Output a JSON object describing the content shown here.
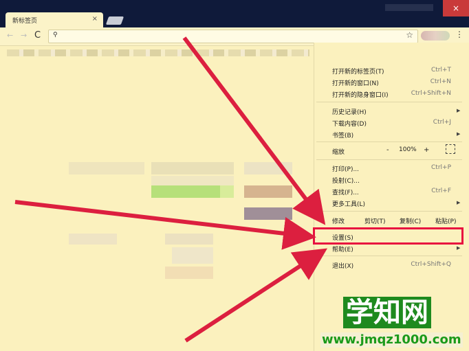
{
  "browser": {
    "tab_title": "新标签页",
    "tab_close": "×",
    "window_close": "×",
    "back": "←",
    "forward": "→",
    "reload": "C",
    "menu_icon": "⋮"
  },
  "menu": {
    "items": [
      {
        "label": "打开新的标签页(T)",
        "shortcut": "Ctrl+T"
      },
      {
        "label": "打开新的窗口(N)",
        "shortcut": "Ctrl+N"
      },
      {
        "label": "打开新的隐身窗口(I)",
        "shortcut": "Ctrl+Shift+N"
      },
      {
        "label": "历史记录(H)",
        "shortcut": ""
      },
      {
        "label": "下载内容(D)",
        "shortcut": "Ctrl+J"
      },
      {
        "label": "书签(B)",
        "shortcut": ""
      },
      {
        "label": "缩放",
        "shortcut": ""
      },
      {
        "label": "打印(P)...",
        "shortcut": "Ctrl+P"
      },
      {
        "label": "投射(C)...",
        "shortcut": ""
      },
      {
        "label": "查找(F)...",
        "shortcut": "Ctrl+F"
      },
      {
        "label": "更多工具(L)",
        "shortcut": ""
      },
      {
        "label": "设置(S)",
        "shortcut": ""
      },
      {
        "label": "帮助(E)",
        "shortcut": ""
      },
      {
        "label": "退出(X)",
        "shortcut": "Ctrl+Shift+Q"
      }
    ],
    "zoom": {
      "minus": "-",
      "value": "100%",
      "plus": "+"
    },
    "edit": {
      "label": "修改",
      "cut": "剪切(T)",
      "copy": "复制(C)",
      "paste": "粘贴(P)"
    }
  },
  "watermark": {
    "title": "学知网",
    "url": "www.jmqz1000.com"
  },
  "colors": {
    "page_bg": "#fbf1be",
    "titlebar": "#0f1a3a",
    "highlight": "#e8103f",
    "arrow": "#dc1f3f",
    "watermark_green": "#1e8a1e"
  }
}
